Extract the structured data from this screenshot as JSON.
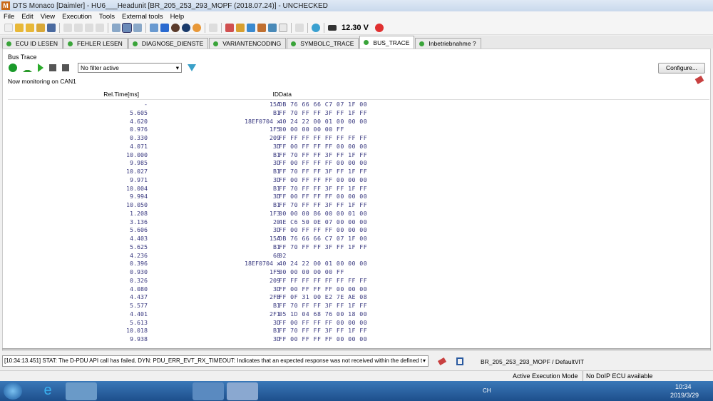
{
  "title": "DTS Monaco [Daimler] - HU6___Headunit [BR_205_253_293_MOPF (2018.07.24)] - UNCHECKED",
  "menu": [
    "File",
    "Edit",
    "View",
    "Execution",
    "Tools",
    "External tools",
    "Help"
  ],
  "voltage": "12.30 V",
  "tabs": [
    {
      "label": "ECU ID LESEN"
    },
    {
      "label": "FEHLER LESEN"
    },
    {
      "label": "DIAGNOSE_DIENSTE"
    },
    {
      "label": "VARIANTENCODING"
    },
    {
      "label": "SYMBOLC_TRACE"
    },
    {
      "label": "BUS_TRACE",
      "active": true
    },
    {
      "label": "Inbetriebnahme ?"
    }
  ],
  "bus_trace": {
    "label": "Bus Trace",
    "filter": "No filter active",
    "configure": "Configure...",
    "monitoring": "Now monitoring on CAN1",
    "columns": {
      "time": "Rel.Time[ms]",
      "id": "ID",
      "data": "Data"
    },
    "rows": [
      [
        "-",
        "15A",
        "DB 76 66 66 C7 07 1F 00"
      ],
      [
        "5.605",
        "B1",
        "FF 70 FF FF 3F FF 1F FF"
      ],
      [
        "4.620",
        "18EF0704 x",
        "40 24 22 00 01 00 00 00"
      ],
      [
        "0.976",
        "1F5",
        "00 00 00 00 00 FF"
      ],
      [
        "0.330",
        "209",
        "FF FF FF FF FF FF FF FF"
      ],
      [
        "4.071",
        "3D",
        "FF 00 FF FF FF 00 00 00"
      ],
      [
        "10.000",
        "B1",
        "FF 70 FF FF 3F FF 1F FF"
      ],
      [
        "9.985",
        "3D",
        "FF 00 FF FF FF 00 00 00"
      ],
      [
        "10.027",
        "B1",
        "FF 70 FF FF 3F FF 1F FF"
      ],
      [
        "9.971",
        "3D",
        "FF 00 FF FF FF 00 00 00"
      ],
      [
        "10.004",
        "B1",
        "FF 70 FF FF 3F FF 1F FF"
      ],
      [
        "9.994",
        "3D",
        "FF 00 FF FF FF 00 00 00"
      ],
      [
        "10.050",
        "B1",
        "FF 70 FF FF 3F FF 1F FF"
      ],
      [
        "1.208",
        "1F3",
        "00 00 00 86 00 00 01 00"
      ],
      [
        "3.136",
        "20",
        "4E C6 50 0E 07 00 00 00"
      ],
      [
        "5.606",
        "3D",
        "FF 00 FF FF FF 00 00 00"
      ],
      [
        "4.403",
        "15A",
        "DB 76 66 66 C7 07 1F 00"
      ],
      [
        "5.625",
        "B1",
        "FF 70 FF FF 3F FF 1F FF"
      ],
      [
        "4.236",
        "68",
        "02"
      ],
      [
        "0.396",
        "18EF0704 x",
        "40 24 22 00 01 00 00 00"
      ],
      [
        "0.930",
        "1F5",
        "00 00 00 00 00 FF"
      ],
      [
        "0.326",
        "209",
        "FF FF FF FF FF FF FF FF"
      ],
      [
        "4.080",
        "3D",
        "FF 00 FF FF FF 00 00 00"
      ],
      [
        "4.437",
        "2FB",
        "FF 0F 31 00 E2 7E AE 08"
      ],
      [
        "5.577",
        "B1",
        "FF 70 FF FF 3F FF 1F FF"
      ],
      [
        "4.401",
        "2F1",
        "05 1D 04 68 76 00 18 00"
      ],
      [
        "5.613",
        "3D",
        "FF 00 FF FF FF 00 00 00"
      ],
      [
        "10.018",
        "B1",
        "FF 70 FF FF 3F FF 1F FF"
      ],
      [
        "9.938",
        "3D",
        "FF 00 FF FF FF 00 00 00"
      ]
    ]
  },
  "status_message": "[10:34:13.451] STAT: The D-PDU API call has failed, DYN: PDU_ERR_EVT_RX_TIMEOUT: Indicates that an expected response was not received within the defined t",
  "vit": "BR_205_253_293_MOPF / DefaultVIT",
  "statusbar": {
    "mode": "Active Execution Mode",
    "doip": "No DoIP ECU available"
  },
  "taskbar": {
    "time": "10:34",
    "date": "2019/3/29",
    "lang": "CH"
  }
}
